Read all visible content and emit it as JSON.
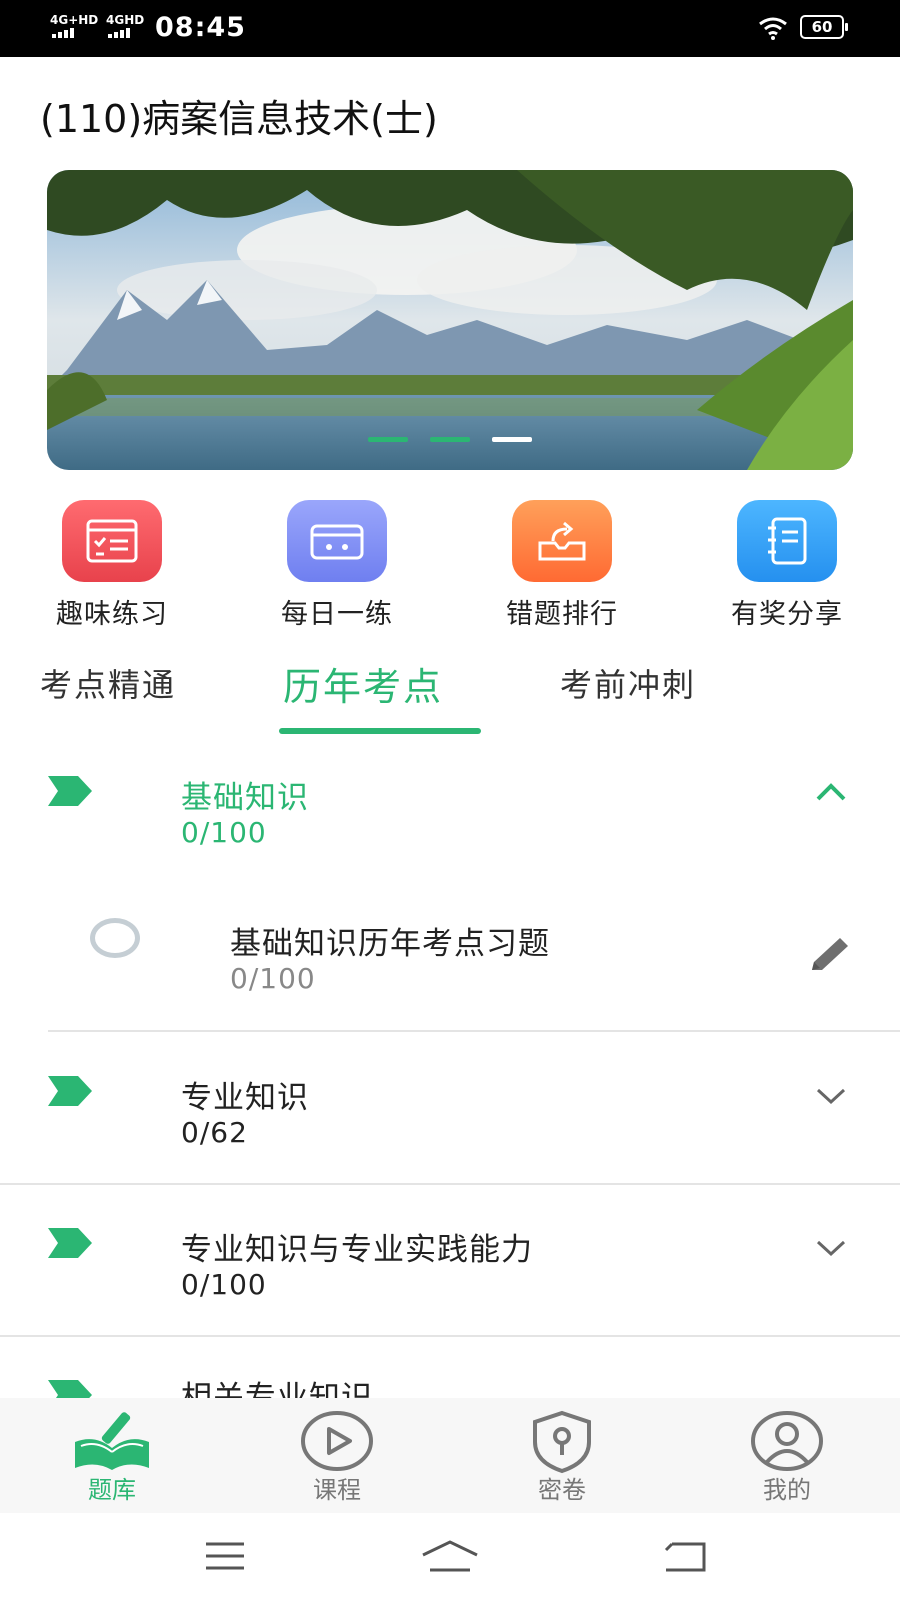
{
  "status_bar": {
    "network_1": "4G+HD",
    "network_2": "4GHD",
    "time": "08:45",
    "battery": "60"
  },
  "page": {
    "title": "(110)病案信息技术(士)"
  },
  "banner": {
    "slide_count": 3,
    "active_slide": 3
  },
  "quick_actions": [
    {
      "label": "趣味练习",
      "icon": "quiz-list-icon",
      "color": "#f0505a"
    },
    {
      "label": "每日一练",
      "icon": "radio-box-icon",
      "color": "#7e8cf6"
    },
    {
      "label": "错题排行",
      "icon": "share-folder-icon",
      "color": "#ff7a3d"
    },
    {
      "label": "有奖分享",
      "icon": "notebook-icon",
      "color": "#2ea0f5"
    }
  ],
  "tabs": [
    {
      "label": "考点精通",
      "active": false
    },
    {
      "label": "历年考点",
      "active": true
    },
    {
      "label": "考前冲刺",
      "active": false
    }
  ],
  "sections": [
    {
      "title": "基础知识",
      "count": "0/100",
      "expanded": true,
      "children": [
        {
          "title": "基础知识历年考点习题",
          "count": "0/100"
        }
      ]
    },
    {
      "title": "专业知识",
      "count": "0/62",
      "expanded": false
    },
    {
      "title": "专业知识与专业实践能力",
      "count": "0/100",
      "expanded": false
    },
    {
      "title": "相关专业知识",
      "expanded": false
    }
  ],
  "bottom_nav": [
    {
      "label": "题库",
      "icon": "question-bank-icon",
      "active": true
    },
    {
      "label": "课程",
      "icon": "play-circle-icon",
      "active": false
    },
    {
      "label": "密卷",
      "icon": "shield-lock-icon",
      "active": false
    },
    {
      "label": "我的",
      "icon": "user-profile-icon",
      "active": false
    }
  ],
  "colors": {
    "accent": "#2bb673",
    "text": "#222222",
    "muted": "#888888"
  }
}
